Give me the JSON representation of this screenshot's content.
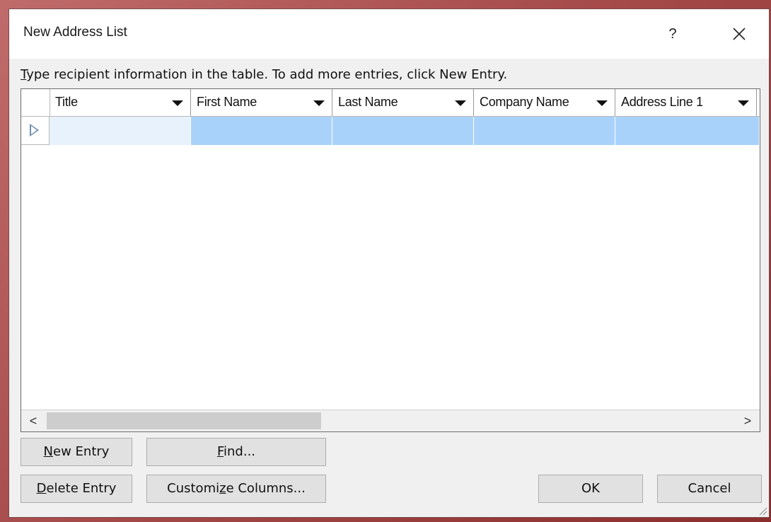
{
  "window": {
    "title": "New Address List",
    "help_label": "?",
    "close_label": "✕"
  },
  "instruction": {
    "underlined_char": "T",
    "rest": "ype recipient information in the table.  To add more entries, click New Entry."
  },
  "table": {
    "columns": [
      {
        "label": "Title"
      },
      {
        "label": "First Name"
      },
      {
        "label": "Last Name"
      },
      {
        "label": "Company Name"
      },
      {
        "label": "Address Line 1"
      }
    ],
    "rows": [
      {
        "values": [
          "",
          "",
          "",
          "",
          ""
        ],
        "selected": true
      }
    ]
  },
  "scrollbar": {
    "left_arrow": "<",
    "right_arrow": ">"
  },
  "buttons": {
    "new_entry": {
      "mnemonic": "N",
      "rest": "ew Entry"
    },
    "find": {
      "mnemonic": "F",
      "rest": "ind..."
    },
    "delete_entry": {
      "mnemonic": "D",
      "rest": "elete Entry"
    },
    "customize_columns": {
      "before": "Customi",
      "mnemonic": "z",
      "after": "e Columns..."
    },
    "ok": "OK",
    "cancel": "Cancel"
  },
  "colors": {
    "selected_row": "#a9d2fb",
    "first_cell": "#e8f2fc",
    "frame_accent": "#a44848"
  }
}
